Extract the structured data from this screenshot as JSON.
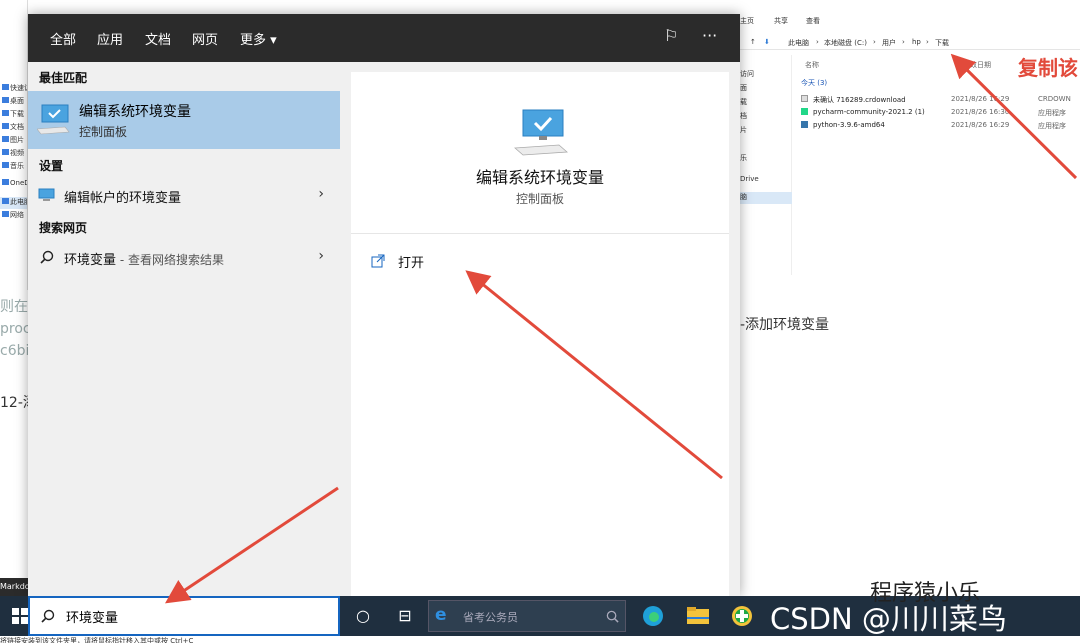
{
  "background": {
    "left_nav": [
      "快速访",
      "桌面",
      "下载",
      "文档",
      "图片",
      "视频",
      "音乐",
      "OneDr",
      "此电脑",
      "网络"
    ],
    "left_text_lines": [
      "则在这",
      "proc",
      "c6bit"
    ],
    "left_text_2": "12-添",
    "explorer": {
      "ribbon": [
        "主页",
        "共享",
        "查看"
      ],
      "breadcrumb": [
        "此电脑",
        "本地磁盘 (C:)",
        "用户",
        "hp",
        "下载"
      ],
      "columns": {
        "name": "名称",
        "modified": "修改日期"
      },
      "group_label": "今天 (3)",
      "nav_items": [
        "访问",
        "面",
        "载",
        "档",
        "片",
        "乐",
        "Drive",
        "脑"
      ],
      "files": [
        {
          "name": "未确认 716289.crdownload",
          "date": "2021/8/26 16:29",
          "type": "CRDOWN"
        },
        {
          "name": "pycharm-community-2021.2 (1)",
          "date": "2021/8/26 16:30",
          "type": "应用程序"
        },
        {
          "name": "python-3.9.6-amd64",
          "date": "2021/8/26 16:29",
          "type": "应用程序"
        }
      ]
    },
    "annotation": "复制该",
    "right_text": "-添加环境变量",
    "markdown_tab": "Markdo",
    "bottom_text": "将链接安装到该文件夹里，请将鼠标指针移入其中或按 Ctrl+C"
  },
  "tabs": [
    "全部",
    "应用",
    "文档",
    "网页",
    "更多 ▾"
  ],
  "top_icons": {
    "feedback": "⚐",
    "more": "···"
  },
  "left_pane": {
    "best_match_title": "最佳匹配",
    "best_match": {
      "title": "编辑系统环境变量",
      "subtitle": "控制面板"
    },
    "settings_title": "设置",
    "settings_item": "编辑帐户的环境变量",
    "web_title": "搜索网页",
    "web_item": "环境变量",
    "web_item_suffix": " - 查看网络搜索结果"
  },
  "right_pane": {
    "title": "编辑系统环境变量",
    "subtitle": "控制面板",
    "open_label": "打开"
  },
  "taskbar": {
    "search_value": "环境变量",
    "ie_placeholder": "省考公务员"
  },
  "watermark": {
    "csdn": "CSDN @川川菜鸟",
    "wechat": "程序猿小乐"
  },
  "colors": {
    "accent": "#1565c0",
    "selection": "#a9cbe8",
    "arrow": "#e24a3b",
    "topbar": "#2b2b2b"
  }
}
